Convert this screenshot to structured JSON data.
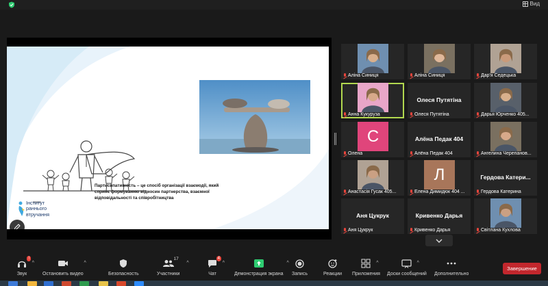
{
  "window": {
    "view_label": "Вид"
  },
  "slide": {
    "text": "Партисипативність – це спосіб організації взаємодії, який сприяє формуванню відносин партнерства, взаємної відповідальності та співробітництва",
    "logo_line1": "Інститут",
    "logo_line2": "раннього",
    "logo_line3": "втручання"
  },
  "participants": [
    {
      "name": "Аліна Синиця",
      "kind": "video"
    },
    {
      "name": "Аліна Синиця",
      "kind": "video"
    },
    {
      "name": "Дар'я Седецька",
      "kind": "video"
    },
    {
      "name": "Анна Кукуруза",
      "kind": "video",
      "active": true
    },
    {
      "name": "Олеся Путятіна",
      "kind": "name",
      "big": "Олеся Путятіна"
    },
    {
      "name": "Дарья Юрченко 405...",
      "kind": "video"
    },
    {
      "name": "Олена",
      "kind": "letter",
      "letter": "С"
    },
    {
      "name": "Алёна Педак 404",
      "kind": "name",
      "big": "Алёна Педак 404"
    },
    {
      "name": "Ангелина Черепанов...",
      "kind": "video"
    },
    {
      "name": "Анастасія Гусак 405...",
      "kind": "video"
    },
    {
      "name": "Елена Димидюк 404 ...",
      "kind": "letter",
      "letter": "Л"
    },
    {
      "name": "Гердова Катерина",
      "kind": "name",
      "big": "Гердова  Катери..."
    },
    {
      "name": "Аня Цукрук",
      "kind": "name",
      "big": "Аня Цукрук"
    },
    {
      "name": "Кривенко Дарья",
      "kind": "name",
      "big": "Кривенко Дарья"
    },
    {
      "name": "Світлана Кухлова",
      "kind": "video"
    }
  ],
  "toolbar": {
    "audio": "Звук",
    "video": "Остановить видео",
    "security": "Безопасность",
    "participants": "Участники",
    "participants_count": "17",
    "chat": "Чат",
    "chat_badge": "4",
    "share": "Демонстрация экрана",
    "record": "Запись",
    "reactions": "Реакции",
    "apps": "Приложения",
    "whiteboards": "Доски сообщений",
    "more": "Дополнительно",
    "end": "Завершение"
  },
  "colors": {
    "end_button": "#c2272d",
    "share_active": "#2ecc71",
    "active_speaker": "#b3d94f"
  }
}
